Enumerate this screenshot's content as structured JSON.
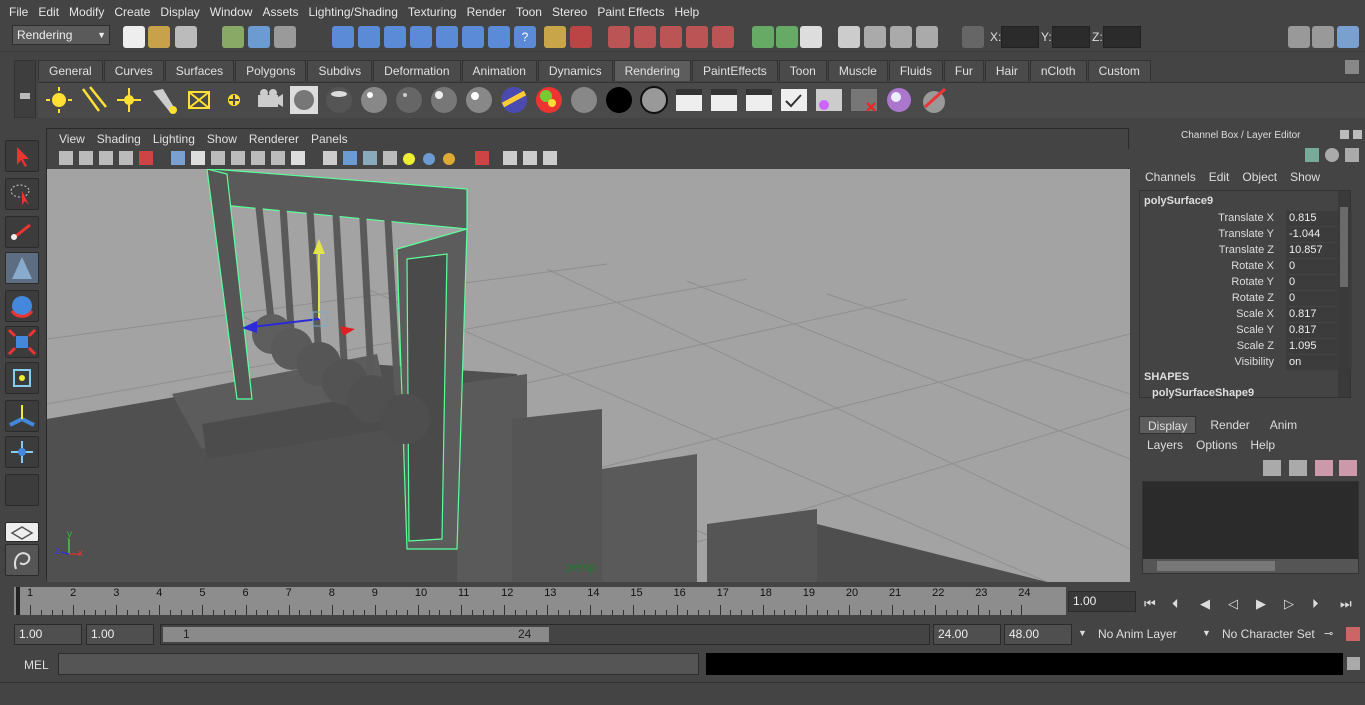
{
  "menubar": {
    "items": [
      "File",
      "Edit",
      "Modify",
      "Create",
      "Display",
      "Window",
      "Assets",
      "Lighting/Shading",
      "Texturing",
      "Render",
      "Toon",
      "Stereo",
      "Paint Effects",
      "Help"
    ]
  },
  "status": {
    "menuset": "Rendering",
    "x_label": "X:",
    "y_label": "Y:",
    "z_label": "Z:"
  },
  "shelf": {
    "tabs": [
      "General",
      "Curves",
      "Surfaces",
      "Polygons",
      "Subdivs",
      "Deformation",
      "Animation",
      "Dynamics",
      "Rendering",
      "PaintEffects",
      "Toon",
      "Muscle",
      "Fluids",
      "Fur",
      "Hair",
      "nCloth",
      "Custom"
    ],
    "active_tab": "Rendering",
    "icons": [
      "ambient-light-icon",
      "directional-light-icon",
      "point-light-icon",
      "spot-light-icon",
      "area-light-icon",
      "volume-light-icon",
      "camera-icon",
      "lambert-sphere-icon",
      "blinn-sphere-icon",
      "phong-sphere-icon",
      "phong-e-sphere-icon",
      "anisotropic-sphere-icon",
      "layered-shader-icon",
      "ramp-shader-icon",
      "surface-shader-icon",
      "use-background-icon",
      "black-sphere-icon",
      "grey-sphere-icon",
      "render-view-icon",
      "render-current-icon",
      "ipr-render-icon",
      "render-settings-icon",
      "hypershade-icon",
      "batch-render-icon",
      "light-linking-icon",
      "paint-effects-icon"
    ]
  },
  "viewport": {
    "menu": [
      "View",
      "Shading",
      "Lighting",
      "Show",
      "Renderer",
      "Panels"
    ],
    "camera_label": "persp",
    "axis_y": "y",
    "axis_z": "z",
    "axis_x": "x"
  },
  "channelbox": {
    "title": "Channel Box / Layer Editor",
    "menu": [
      "Channels",
      "Edit",
      "Object",
      "Show"
    ],
    "object": "polySurface9",
    "attributes": [
      {
        "label": "Translate X",
        "value": "0.815"
      },
      {
        "label": "Translate Y",
        "value": "-1.044"
      },
      {
        "label": "Translate Z",
        "value": "10.857"
      },
      {
        "label": "Rotate X",
        "value": "0"
      },
      {
        "label": "Rotate Y",
        "value": "0"
      },
      {
        "label": "Rotate Z",
        "value": "0"
      },
      {
        "label": "Scale X",
        "value": "0.817"
      },
      {
        "label": "Scale Y",
        "value": "0.817"
      },
      {
        "label": "Scale Z",
        "value": "1.095"
      },
      {
        "label": "Visibility",
        "value": "on"
      }
    ],
    "shapes_header": "SHAPES",
    "shape_name": "polySurfaceShape9",
    "layer_tabs": [
      "Display",
      "Render",
      "Anim"
    ],
    "layer_menu": [
      "Layers",
      "Options",
      "Help"
    ]
  },
  "timeline": {
    "ticks": [
      "1",
      "2",
      "3",
      "4",
      "5",
      "6",
      "7",
      "8",
      "9",
      "10",
      "11",
      "12",
      "13",
      "14",
      "15",
      "16",
      "17",
      "18",
      "19",
      "20",
      "21",
      "22",
      "23",
      "24"
    ],
    "current_frame": "1.00"
  },
  "range": {
    "start": "1.00",
    "playback_start": "1.00",
    "slider_start": "1",
    "slider_end": "24",
    "playback_end": "24.00",
    "end": "48.00",
    "anim_layer": "No Anim Layer",
    "char_set": "No Character Set"
  },
  "cmdline": {
    "label": "MEL"
  }
}
